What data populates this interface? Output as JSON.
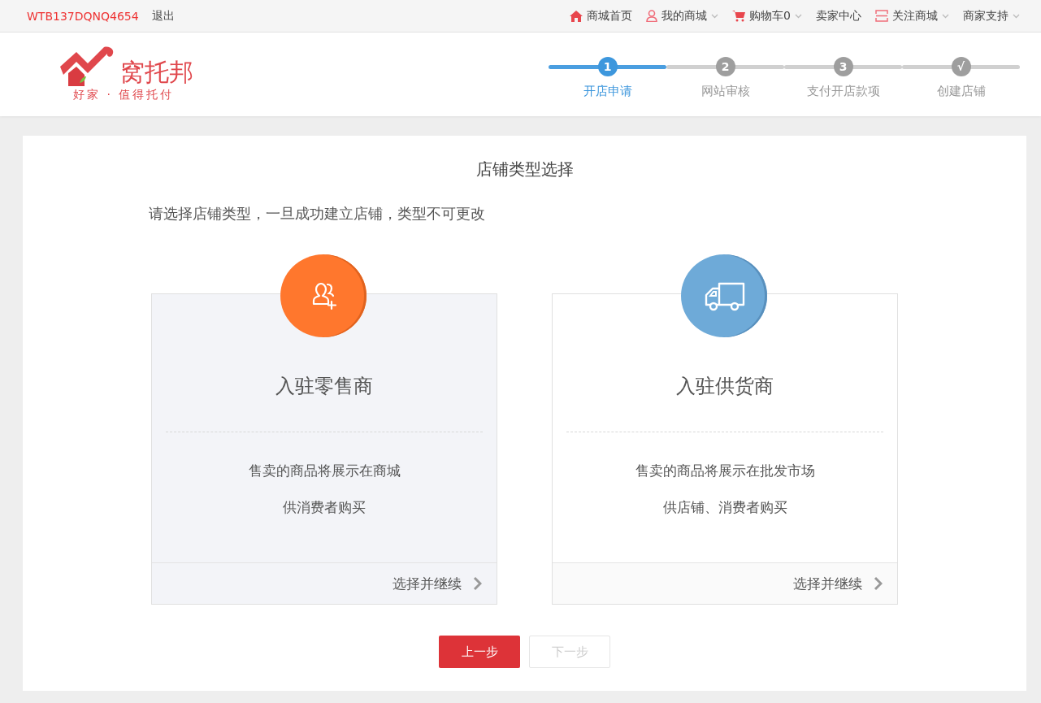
{
  "top_bar": {
    "account": "WTB137DQNQ4654",
    "logout": "退出",
    "nav": [
      {
        "kind": "home",
        "label": "商城首页",
        "dropdown": false
      },
      {
        "kind": "user",
        "label": "我的商城",
        "dropdown": true
      },
      {
        "kind": "cart",
        "label": "购物车",
        "count": "0",
        "dropdown": true
      },
      {
        "kind": "plain",
        "label": "卖家中心",
        "dropdown": false
      },
      {
        "kind": "follow",
        "label": "关注商城",
        "dropdown": true
      },
      {
        "kind": "plain",
        "label": "商家支持",
        "dropdown": true
      }
    ]
  },
  "logo": {
    "name": "窝托邦",
    "slogan": "好家 · 值得托付"
  },
  "steps": [
    {
      "number": "1",
      "label": "开店申请",
      "selected": true
    },
    {
      "number": "2",
      "label": "网站审核",
      "selected": false
    },
    {
      "number": "3",
      "label": "支付开店款项",
      "selected": false
    },
    {
      "number": "√",
      "label": "创建店铺",
      "selected": false
    }
  ],
  "panel": {
    "title": "店铺类型选择",
    "notice": "请选择店铺类型，一旦成功建立店铺，类型不可更改",
    "options": [
      {
        "kind": "retailer",
        "title": "入驻零售商",
        "lines": [
          "售卖的商品将展示在商城",
          "供消费者购买"
        ],
        "action": "选择并继续",
        "selected": true
      },
      {
        "kind": "supplier",
        "title": "入驻供货商",
        "lines": [
          "售卖的商品将展示在批发市场",
          "供店铺、消费者购买"
        ],
        "action": "选择并继续",
        "selected": false
      }
    ],
    "buttons": [
      {
        "label": "上一步",
        "disabled": false
      },
      {
        "label": "下一步",
        "disabled": true
      }
    ]
  }
}
